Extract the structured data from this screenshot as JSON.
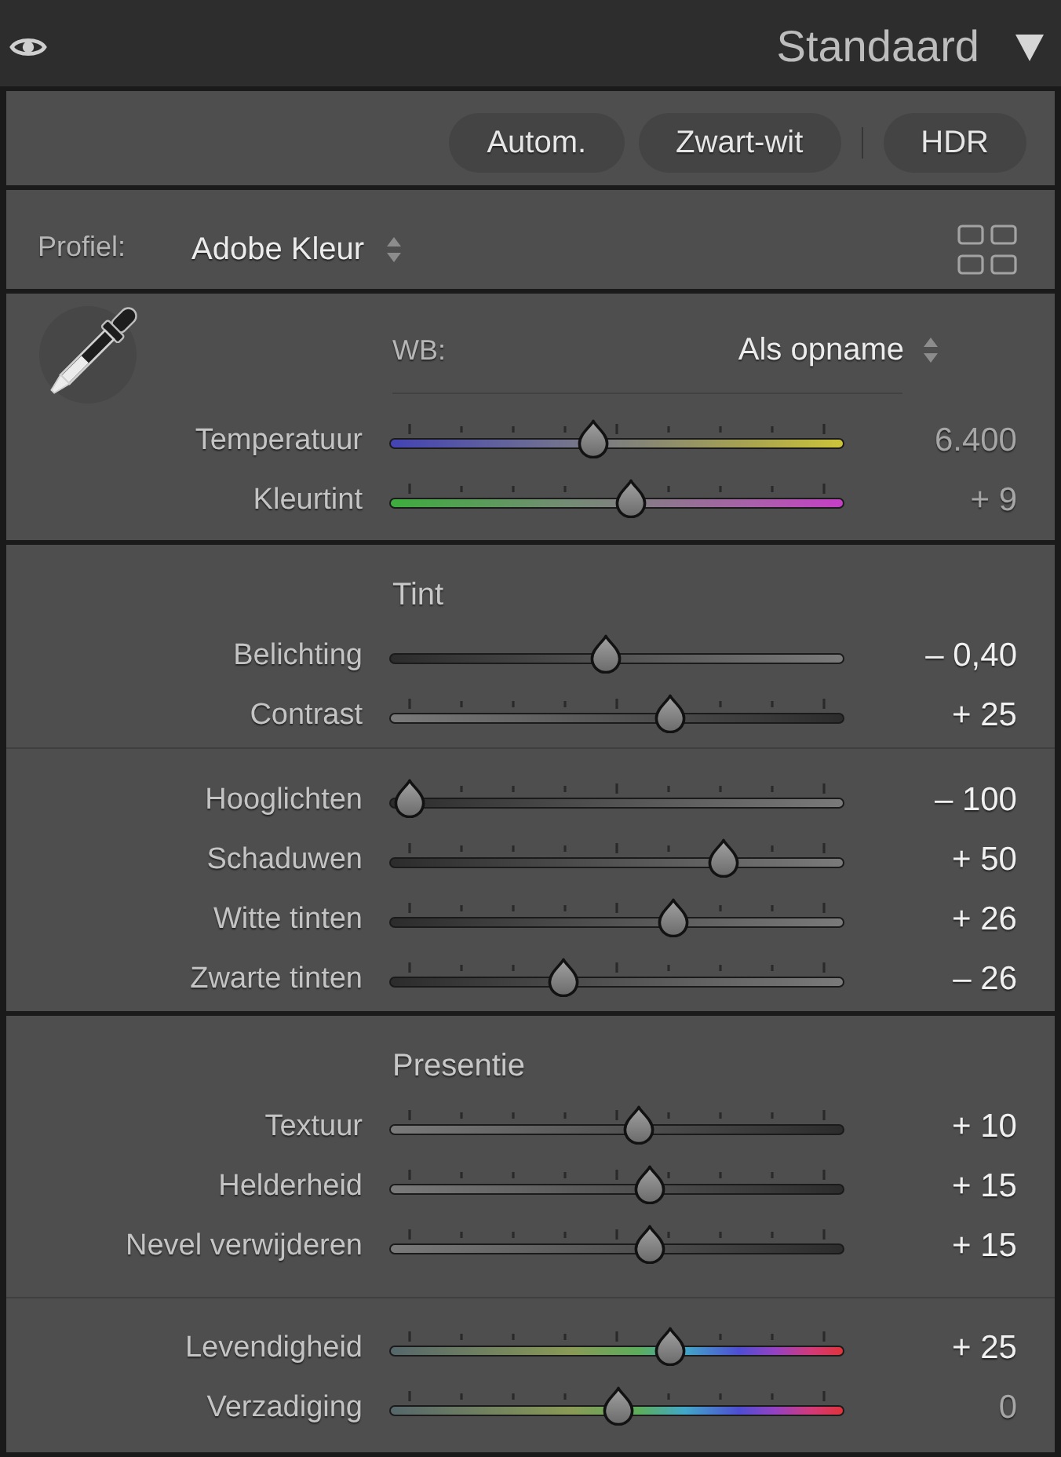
{
  "header": {
    "title": "Standaard",
    "expanded": true
  },
  "presets": {
    "groups": [
      [
        "Autom.",
        "Zwart-wit"
      ],
      [
        "HDR"
      ]
    ]
  },
  "profile": {
    "label": "Profiel:",
    "value": "Adobe Kleur"
  },
  "white_balance": {
    "label": "WB:",
    "value": "Als opname",
    "sliders": [
      {
        "label": "Temperatuur",
        "value": "6.400",
        "level": 0.44,
        "kind": "temperature",
        "ticks": true,
        "modified": false
      },
      {
        "label": "Kleurtint",
        "value": "+ 9",
        "level": 0.53,
        "kind": "tint",
        "ticks": true,
        "modified": false
      }
    ]
  },
  "sections": [
    {
      "title": "Tint",
      "groups": [
        [
          {
            "label": "Belichting",
            "value": "– 0,40",
            "level": 0.47,
            "kind": "tone-rising",
            "ticks": false,
            "modified": true
          },
          {
            "label": "Contrast",
            "value": "+ 25",
            "level": 0.625,
            "kind": "tone-falling",
            "ticks": true,
            "modified": true
          }
        ],
        [
          {
            "label": "Hooglichten",
            "value": "– 100",
            "level": 0,
            "kind": "tone-rising",
            "ticks": true,
            "modified": true
          },
          {
            "label": "Schaduwen",
            "value": "+ 50",
            "level": 0.75,
            "kind": "tone-rising",
            "ticks": true,
            "modified": true
          },
          {
            "label": "Witte tinten",
            "value": "+ 26",
            "level": 0.63,
            "kind": "tone-rising",
            "ticks": true,
            "modified": true
          },
          {
            "label": "Zwarte tinten",
            "value": "– 26",
            "level": 0.37,
            "kind": "tone-rising",
            "ticks": true,
            "modified": true
          }
        ]
      ]
    },
    {
      "title": "Presentie",
      "groups": [
        [
          {
            "label": "Textuur",
            "value": "+ 10",
            "level": 0.55,
            "kind": "tone-falling",
            "ticks": true,
            "modified": true
          },
          {
            "label": "Helderheid",
            "value": "+ 15",
            "level": 0.575,
            "kind": "tone-falling",
            "ticks": true,
            "modified": true
          },
          {
            "label": "Nevel verwijderen",
            "value": "+ 15",
            "level": 0.575,
            "kind": "tone-falling",
            "ticks": true,
            "modified": true
          }
        ],
        [
          {
            "label": "Levendigheid",
            "value": "+ 25",
            "level": 0.625,
            "kind": "spectrum",
            "ticks": true,
            "modified": true
          },
          {
            "label": "Verzadiging",
            "value": "0",
            "level": 0.5,
            "kind": "spectrum",
            "ticks": true,
            "modified": false
          }
        ]
      ]
    }
  ]
}
